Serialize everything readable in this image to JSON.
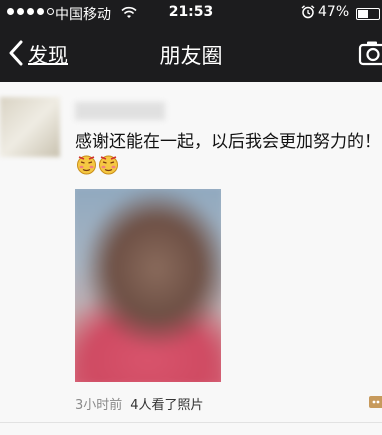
{
  "status_bar": {
    "carrier": "中国移动",
    "time": "21:53",
    "battery_percent": "47%",
    "battery_level": 0.47
  },
  "nav": {
    "back_label": "发现",
    "title": "朋友圈"
  },
  "post": {
    "text": "感谢还能在一起，以后我会更加努力的！",
    "time_ago": "3小时前",
    "views": "4人看了照片"
  },
  "icons": {
    "back": "chevron-left-icon",
    "camera": "camera-icon",
    "emoji": "blushing-face-icon",
    "comment": "comment-icon"
  }
}
